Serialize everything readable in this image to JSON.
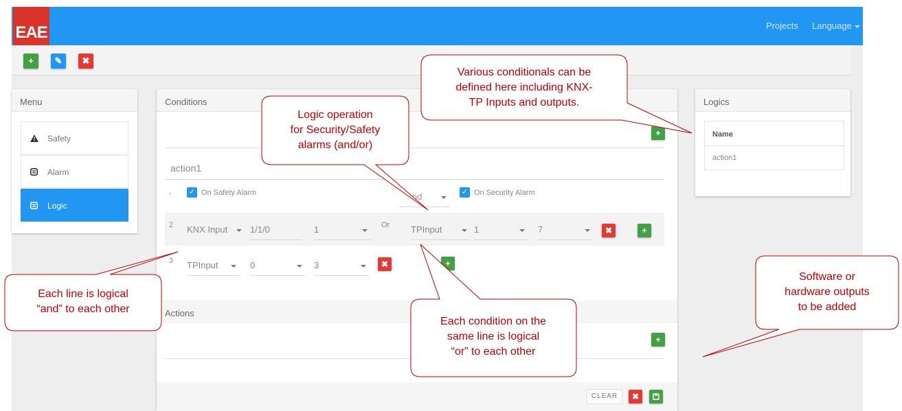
{
  "navbar": {
    "logo": "EAE",
    "projects_label": "Projects",
    "language_label": "Language"
  },
  "toolbar": {
    "add_label": "+",
    "edit_label": "✎",
    "delete_label": "✖"
  },
  "menu": {
    "title": "Menu",
    "items": [
      {
        "label": "Safety",
        "icon": "warning-icon"
      },
      {
        "label": "Alarm",
        "icon": "alarm-icon"
      },
      {
        "label": "Logic",
        "icon": "logic-icon",
        "active": true
      }
    ]
  },
  "conditions": {
    "title": "Conditions",
    "name_value": "action1",
    "row1": {
      "index": "-",
      "safety_label": "On Safety Alarm",
      "operator": "nd",
      "security_label": "On Security Alarm"
    },
    "row2": {
      "index": "2",
      "type": "KNX Input",
      "address": "1/1/0",
      "value": "1",
      "or_label": "Or",
      "type2": "TPInput",
      "val2": "1",
      "val3": "7"
    },
    "row3": {
      "index": "3",
      "type": "TPInput",
      "val1": "0",
      "val2": "3"
    }
  },
  "actions": {
    "title": "Actions",
    "clear_label": "CLEAR"
  },
  "logics": {
    "title": "Logics",
    "column": "Name",
    "rows": [
      "action1"
    ]
  },
  "callouts": {
    "c1": [
      "Various conditionals can be",
      "defined here including KNX-",
      "TP Inputs and outputs."
    ],
    "c2": [
      "Logic operation",
      "for Security/Safety",
      "alarms (and/or)"
    ],
    "c3": [
      "Each line is logical",
      "“and” to each other"
    ],
    "c4": [
      "Each condition on the",
      "same line is logical",
      "“or” to each other"
    ],
    "c5": [
      "Software or",
      "hardware outputs",
      "to be added"
    ]
  },
  "colors": {
    "navbar": "#2196f3",
    "logo": "#d9332a",
    "green": "#43a047",
    "red": "#e53935",
    "callout": "#c00000"
  }
}
